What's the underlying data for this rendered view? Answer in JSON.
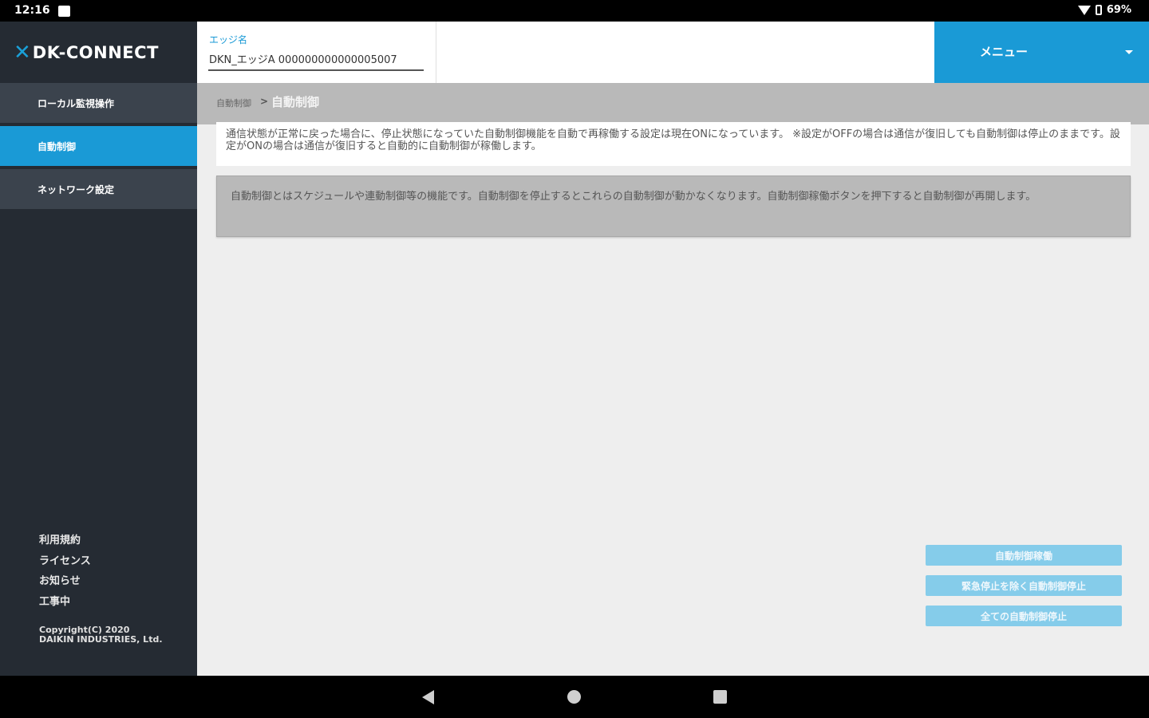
{
  "status_bar": {
    "time": "12:16",
    "battery": "69%"
  },
  "sidebar": {
    "logo_text": "DK-CONNECT",
    "items": [
      {
        "label": "ローカル監視操作"
      },
      {
        "label": "自動制御"
      },
      {
        "label": "ネットワーク設定"
      }
    ],
    "footer_links": [
      "利用規約",
      "ライセンス",
      "お知らせ",
      "工事中"
    ],
    "copyright": "Copyright(C) 2020 DAIKIN INDUSTRIES, Ltd."
  },
  "header": {
    "edge_label": "エッジ名",
    "edge_value": "DKN_エッジA 000000000000005007",
    "menu_label": "メニュー"
  },
  "breadcrumb": {
    "parent": "自動制御",
    "separator": ">",
    "current": "自動制御"
  },
  "main": {
    "notice_info": "通信状態が正常に戻った場合に、停止状態になっていた自動制御機能を自動で再稼働する設定は現在ONになっています。 ※設定がOFFの場合は通信が復旧しても自動制御は停止のままです。設定がONの場合は通信が復旧すると自動的に自動制御が稼働します。",
    "notice_desc": "自動制御とはスケジュールや連動制御等の機能です。自動制御を停止するとこれらの自動制御が動かなくなります。自動制御稼働ボタンを押下すると自動制御が再開します。",
    "buttons": {
      "start": "自動制御稼働",
      "stop_except_emergency": "緊急停止を除く自動制御停止",
      "stop_all": "全ての自動制御停止"
    }
  },
  "colors": {
    "accent": "#1a9ad6",
    "sidebar_bg": "#252b33",
    "disabled_button": "#85ccea"
  }
}
